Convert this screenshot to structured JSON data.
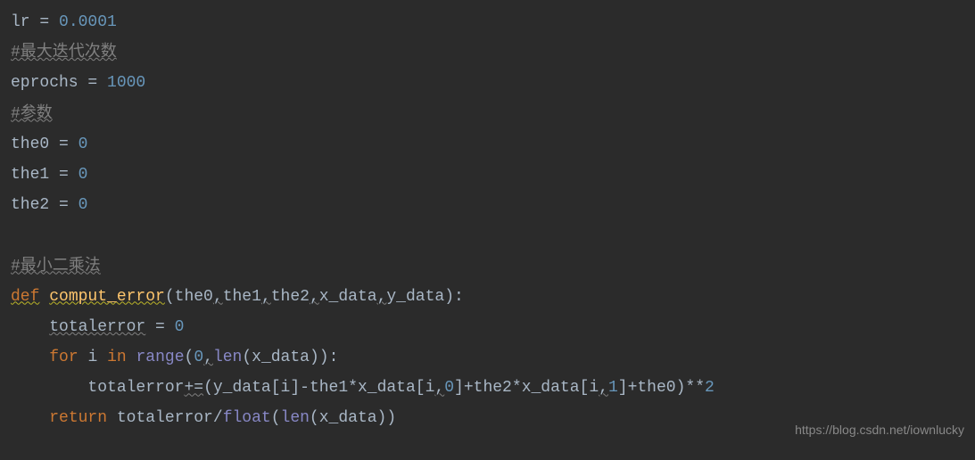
{
  "code": {
    "line1": {
      "var": "lr",
      "op": " = ",
      "num": "0.0001"
    },
    "line2": {
      "comment": "#最大迭代次数"
    },
    "line3": {
      "var": "eprochs",
      "op": " = ",
      "num": "1000"
    },
    "line4": {
      "comment": "#参数"
    },
    "line5": {
      "var": "the0",
      "op": " = ",
      "num": "0"
    },
    "line6": {
      "var": "the1",
      "op": " = ",
      "num": "0"
    },
    "line7": {
      "var": "the2",
      "op": " = ",
      "num": "0"
    },
    "line8": {
      "comment": "#最小二乘法"
    },
    "line9": {
      "def": "def",
      "sp1": " ",
      "fname": "comput_error",
      "open": "(",
      "p1": "the0",
      "c1": ",",
      "p2": "the1",
      "c2": ",",
      "p3": "the2",
      "c3": ",",
      "p4": "x_data",
      "c4": ",",
      "p5": "y_data",
      "close": "):"
    },
    "line10": {
      "indent": "    ",
      "var": "totalerror",
      "op": " = ",
      "num": "0"
    },
    "line11": {
      "indent": "    ",
      "for": "for",
      "sp1": " ",
      "i": "i",
      "sp2": " ",
      "in": "in",
      "sp3": " ",
      "range": "range",
      "open": "(",
      "n0": "0",
      "c1": ",",
      "len": "len",
      "open2": "(",
      "xd": "x_data",
      "close2": ")",
      "close": "):"
    },
    "line12": {
      "indent": "        ",
      "var": "totalerror",
      "op1": "+=",
      "open1": "(",
      "yd": "y_data",
      "ob1": "[",
      "i1": "i",
      "cb1": "]",
      "minus": "-",
      "t1": "the1",
      "mul1": "*",
      "xd1": "x_data",
      "ob2": "[",
      "i2": "i",
      "c1": ",",
      "n0": "0",
      "cb2": "]",
      "plus1": "+",
      "t2": "the2",
      "mul2": "*",
      "xd2": "x_data",
      "ob3": "[",
      "i3": "i",
      "c2": ",",
      "n1": "1",
      "cb3": "]",
      "plus2": "+",
      "t0": "the0",
      "close1": ")",
      "pow": "**",
      "two": "2"
    },
    "line13": {
      "indent": "    ",
      "return": "return",
      "sp": " ",
      "var": "totalerror",
      "div": "/",
      "float": "float",
      "open": "(",
      "len": "len",
      "open2": "(",
      "xd": "x_data",
      "close2": ")",
      "close": ")"
    }
  },
  "watermark": "https://blog.csdn.net/iownlucky"
}
